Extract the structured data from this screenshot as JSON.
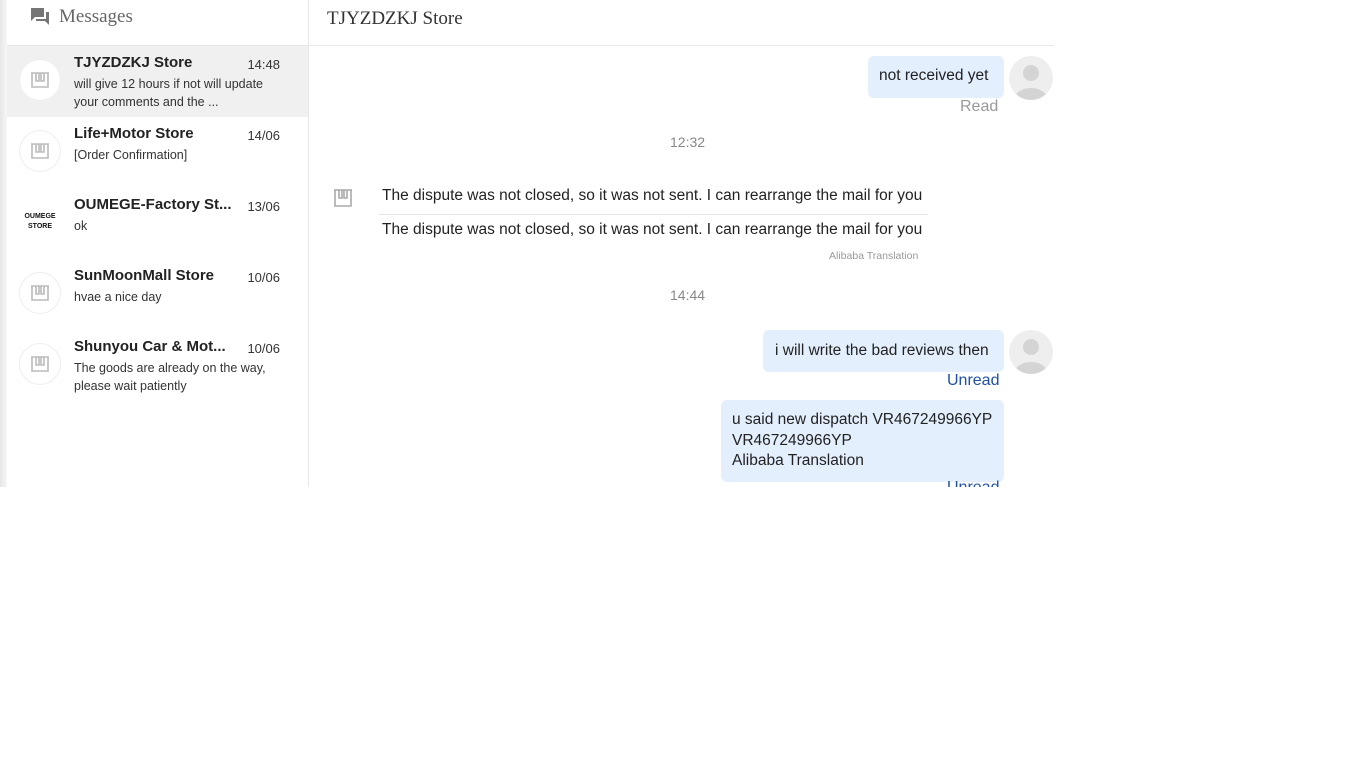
{
  "sidebar": {
    "title": "Messages",
    "icon": "chat-bubbles-icon",
    "conversations": [
      {
        "name": "TJYZDZKJ Store",
        "time": "14:48",
        "preview": "will give 12 hours if not will update your comments and the ...",
        "avatar": "store-icon",
        "active": true
      },
      {
        "name": "Life+Motor Store",
        "time": "14/06",
        "preview": "[Order Confirmation]",
        "avatar": "store-icon"
      },
      {
        "name": "OUMEGE-Factory St...",
        "time": "13/06",
        "preview": "ok",
        "avatar_text": "OUMEGE STORE"
      },
      {
        "name": "SunMoonMall Store",
        "time": "10/06",
        "preview": "hvae a nice day",
        "avatar": "store-icon"
      },
      {
        "name": "Shunyou Car & Mot...",
        "time": "10/06",
        "preview": "The goods are already on the way, please wait patiently",
        "avatar": "store-icon"
      }
    ]
  },
  "chat": {
    "title": "TJYZDZKJ Store",
    "messages": [
      {
        "type": "outgoing",
        "text": "not received yet",
        "status": "Read"
      },
      {
        "type": "timestamp",
        "text": "12:32"
      },
      {
        "type": "incoming",
        "original": "The dispute was not closed, so it was not sent. I can rearrange the mail for you",
        "translated": "The dispute was not closed, so it was not sent. I can rearrange the mail for you",
        "translation_label": "Alibaba Translation"
      },
      {
        "type": "timestamp",
        "text": "14:44"
      },
      {
        "type": "outgoing",
        "text": "i will write the bad reviews then",
        "status": "Unread"
      },
      {
        "type": "outgoing",
        "lines": [
          "u said new dispatch VR467249966YP",
          "VR467249966YP",
          "Alibaba Translation"
        ],
        "status": "Unread"
      }
    ]
  },
  "colors": {
    "outgoing_bubble": "#e3effd",
    "unread": "#1f4fa8",
    "active_conversation": "#f0f0f0"
  }
}
